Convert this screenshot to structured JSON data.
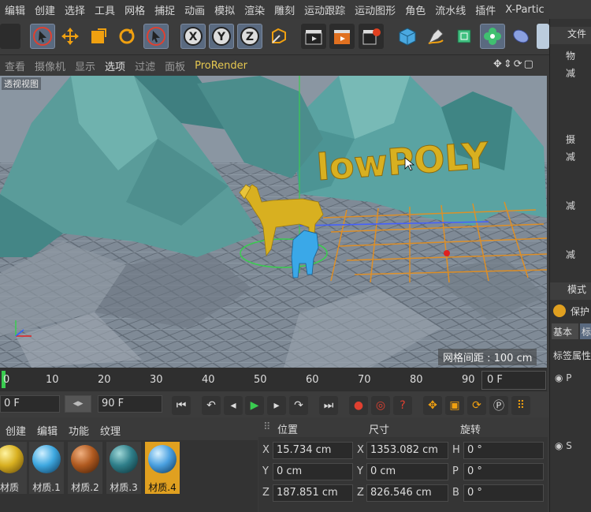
{
  "menubar": [
    "编辑",
    "创建",
    "选择",
    "工具",
    "网格",
    "捕捉",
    "动画",
    "模拟",
    "渲染",
    "雕刻",
    "运动跟踪",
    "运动图形",
    "角色",
    "流水线",
    "插件",
    "X-Partic"
  ],
  "viewport_menu": {
    "items": [
      "查看",
      "摄像机",
      "显示",
      "选项",
      "过滤",
      "面板"
    ],
    "prorender": "ProRender",
    "active": "选项"
  },
  "viewport": {
    "label": "透视视图",
    "grid_info": "网格间距 : 100 cm",
    "scene_text": "lowPOLY"
  },
  "right_panel": {
    "header_top": "文件",
    "tree_items": [
      "物",
      "减",
      "减",
      "摄",
      "减",
      "减",
      "减",
      "减"
    ],
    "attr_header": "模式",
    "protect": "保护",
    "tabs": [
      "基本",
      "标"
    ],
    "tag_label": "标签属性",
    "p_label": "P",
    "s_label": "S"
  },
  "timeline": {
    "ticks": [
      "0",
      "10",
      "20",
      "30",
      "40",
      "50",
      "60",
      "70",
      "80",
      "90"
    ],
    "current_frame": "0 F"
  },
  "playback": {
    "start": "0 F",
    "end": "90 F"
  },
  "material_tabs": [
    "创建",
    "编辑",
    "功能",
    "纹理"
  ],
  "materials": [
    {
      "name": "材质",
      "color": "#d8b020"
    },
    {
      "name": "材质.1",
      "color": "#3ea8e0"
    },
    {
      "name": "材质.2",
      "color": "#b05a20"
    },
    {
      "name": "材质.3",
      "color": "#2f7f8a"
    },
    {
      "name": "材质.4",
      "color": "#4aa0e0"
    }
  ],
  "coordinates": {
    "headers": {
      "position": "位置",
      "size": "尺寸",
      "rotation": "旋转"
    },
    "rows": [
      {
        "axis": "X",
        "pos": "15.734 cm",
        "size_axis": "X",
        "size": "1353.082 cm",
        "rot_axis": "H",
        "rot": "0 °"
      },
      {
        "axis": "Y",
        "pos": "0 cm",
        "size_axis": "Y",
        "size": "0 cm",
        "rot_axis": "P",
        "rot": "0 °"
      },
      {
        "axis": "Z",
        "pos": "187.851 cm",
        "size_axis": "Z",
        "size": "826.546 cm",
        "rot_axis": "B",
        "rot": "0 °"
      }
    ]
  }
}
